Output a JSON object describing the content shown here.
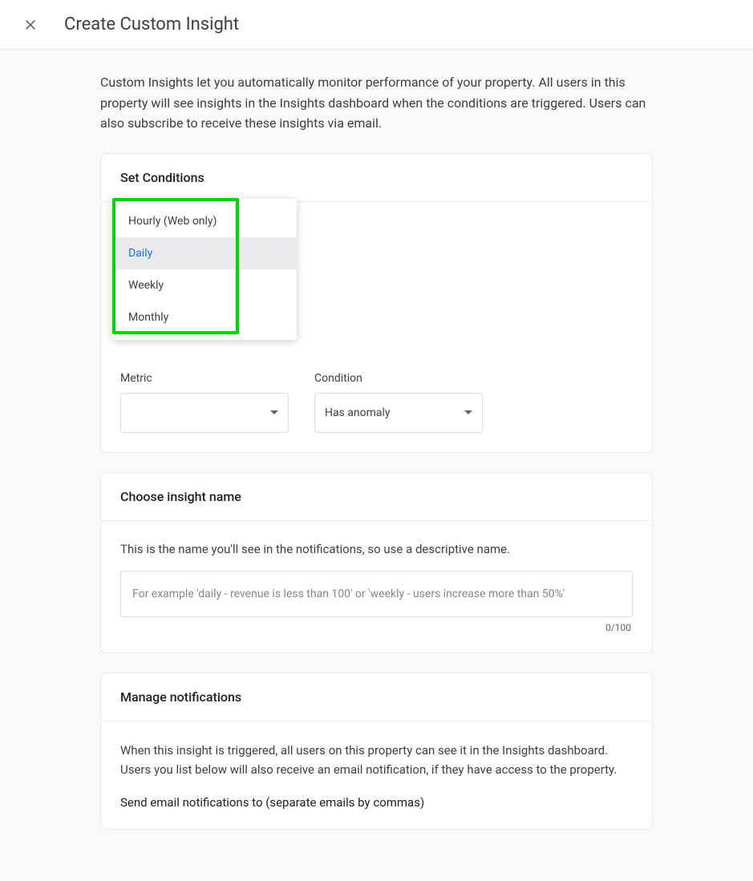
{
  "header": {
    "title": "Create Custom Insight"
  },
  "intro": "Custom Insights let you automatically monitor performance of your property. All users in this property will see insights in the Insights dashboard when the conditions are triggered. Users can also subscribe to receive these insights via email.",
  "conditions": {
    "title": "Set Conditions",
    "frequency_options": {
      "hourly": "Hourly (Web only)",
      "daily": "Daily",
      "weekly": "Weekly",
      "monthly": "Monthly"
    },
    "metric_label": "Metric",
    "metric_value": "",
    "condition_label": "Condition",
    "condition_value": "Has anomaly"
  },
  "insight_name": {
    "title": "Choose insight name",
    "helper": "This is the name you'll see in the notifications, so use a descriptive name.",
    "placeholder": "For example 'daily - revenue is less than 100' or 'weekly - users increase more than 50%'",
    "counter": "0/100"
  },
  "notifications": {
    "title": "Manage notifications",
    "description": "When this insight is triggered, all users on this property can see it in the Insights dashboard. Users you list below will also receive an email notification, if they have access to the property.",
    "email_label": "Send email notifications to (separate emails by commas)"
  }
}
